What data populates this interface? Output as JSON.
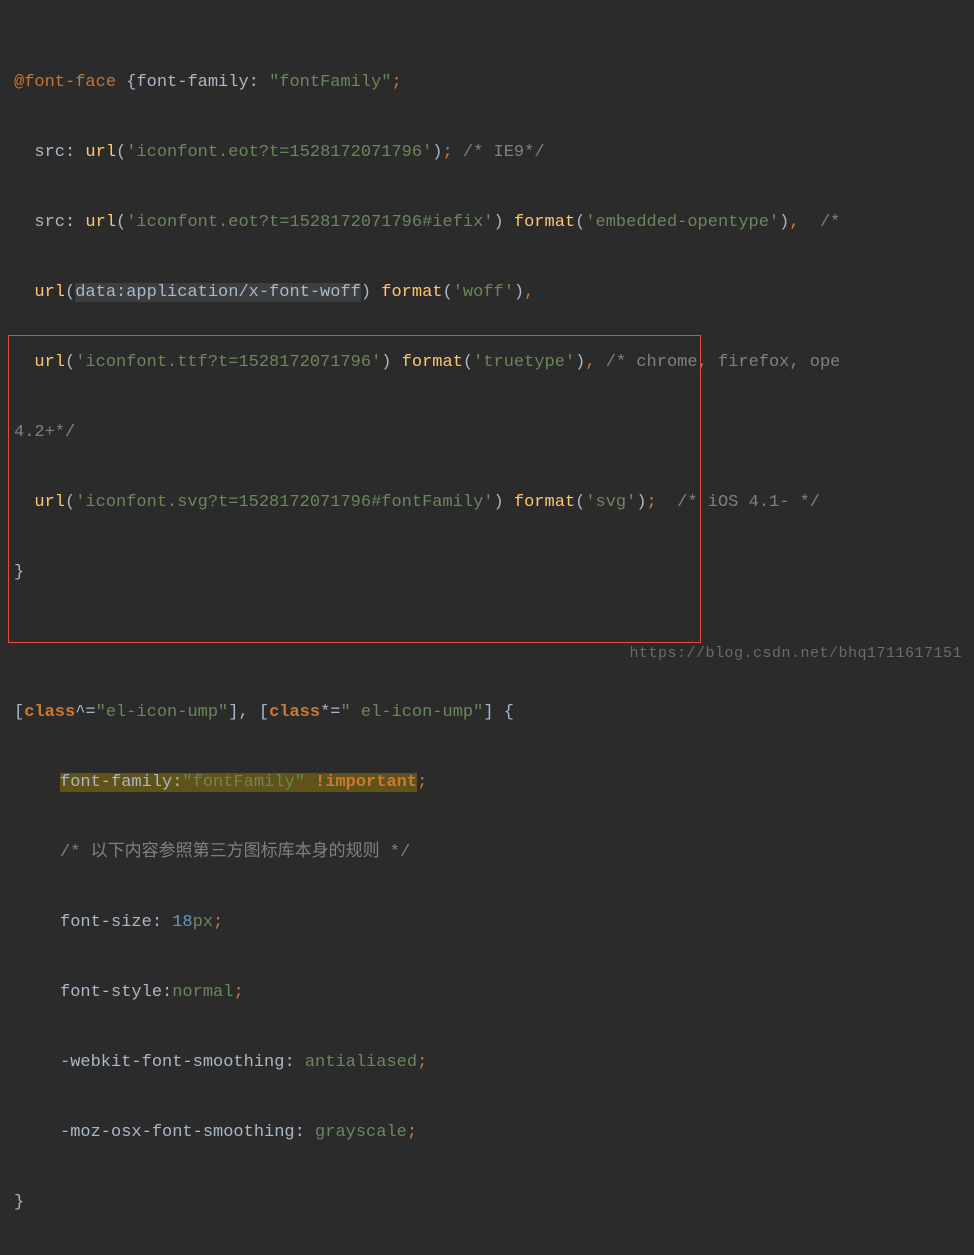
{
  "code": {
    "l1": {
      "at": "@font-face",
      "brace": " {",
      "prop": "font-family",
      "colon": ": ",
      "str": "\"fontFamily\"",
      "semi": ";"
    },
    "l2": {
      "pre": "  ",
      "prop": "src",
      "colon": ": ",
      "fn": "url",
      "p": "(",
      "str": "'iconfont.eot?t=1528172071796'",
      "cp": ")",
      "semi": ";",
      "cmt": " /* IE9*/"
    },
    "l3": {
      "pre": "  ",
      "prop": "src",
      "colon": ": ",
      "fn": "url",
      "p": "(",
      "str": "'iconfont.eot?t=1528172071796#iefix'",
      "cp": ") ",
      "fn2": "format",
      "p2": "(",
      "str2": "'embedded-opentype'",
      "cp2": ")",
      "comma": ",",
      "cmt": "  /* "
    },
    "l4": {
      "pre": "  ",
      "fn": "url",
      "p": "(",
      "data": "data:application/x-font-woff",
      "cp": ") ",
      "fn2": "format",
      "p2": "(",
      "str": "'woff'",
      "cp2": ")",
      "comma": ","
    },
    "l5": {
      "pre": "  ",
      "fn": "url",
      "p": "(",
      "str": "'iconfont.ttf?t=1528172071796'",
      "cp": ") ",
      "fn2": "format",
      "p2": "(",
      "str2": "'truetype'",
      "cp2": ")",
      "comma": ",",
      "cmt": " /* chrome, firefox, ope"
    },
    "l6": {
      "pre": "",
      "cmt": "4.2+*/"
    },
    "l7": {
      "pre": "  ",
      "fn": "url",
      "p": "(",
      "str": "'iconfont.svg?t=1528172071796#fontFamily'",
      "cp": ") ",
      "fn2": "format",
      "p2": "(",
      "str2": "'svg'",
      "cp2": ")",
      "semi": ";",
      "cmt": "  /* iOS 4.1- */"
    },
    "l8": {
      "brace": "}"
    },
    "l9": {
      "open": "[",
      "attr": "class",
      "op": "^=",
      "val": "\"el-icon-ump\"",
      "close": "], ",
      "open2": "[",
      "attr2": "class",
      "op2": "*=",
      "val2": "\" el-icon-ump\"",
      "close2": "] {",
      "he": ""
    },
    "l10": {
      "prop": "font-family",
      "colon": ":",
      "str": "\"fontFamily\"",
      "sp": " ",
      "imp": "!important",
      "semi": ";"
    },
    "l11": {
      "cmt": "/* 以下内容参照第三方图标库本身的规则 */"
    },
    "l12": {
      "prop": "font-size",
      "colon": ": ",
      "num": "18",
      "unit": "px",
      "semi": ";"
    },
    "l13": {
      "prop": "font-style",
      "colon": ":",
      "val": "normal",
      "semi": ";"
    },
    "l14": {
      "prop": "-webkit-font-smoothing",
      "colon": ": ",
      "val": "antialiased",
      "semi": ";"
    },
    "l15": {
      "prop": "-moz-osx-font-smoothing",
      "colon": ": ",
      "val": "grayscale",
      "semi": ";"
    },
    "l16": {
      "brace": "}"
    }
  },
  "watermark": "https://blog.csdn.net/bhq1711617151"
}
